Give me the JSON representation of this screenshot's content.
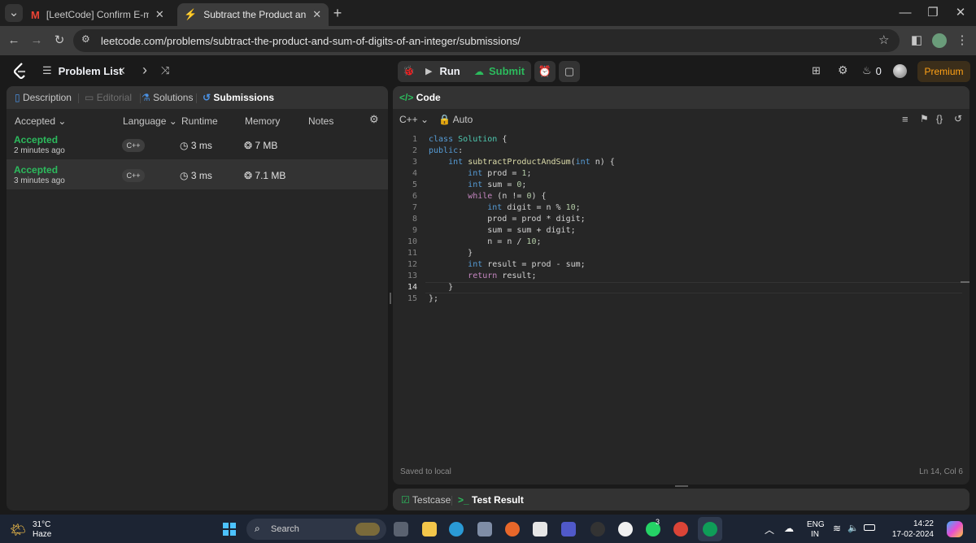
{
  "browser": {
    "tabs": [
      {
        "title": "[LeetCode] Confirm E-mail Add",
        "icon": "gmail-icon"
      },
      {
        "title": "Subtract the Product and Sum o",
        "icon": "leetcode-icon"
      }
    ],
    "url": "leetcode.com/problems/subtract-the-product-and-sum-of-digits-of-an-integer/submissions/"
  },
  "header": {
    "problem_list": "Problem List",
    "run": "Run",
    "submit": "Submit",
    "streak": "0",
    "premium": "Premium"
  },
  "left_panel": {
    "tabs": [
      "Description",
      "Editorial",
      "Solutions",
      "Submissions"
    ],
    "columns": {
      "status": "Accepted",
      "language": "Language",
      "runtime": "Runtime",
      "memory": "Memory",
      "notes": "Notes"
    },
    "submissions": [
      {
        "status": "Accepted",
        "time": "2 minutes ago",
        "lang": "C++",
        "runtime": "3 ms",
        "memory": "7 MB"
      },
      {
        "status": "Accepted",
        "time": "3 minutes ago",
        "lang": "C++",
        "runtime": "3 ms",
        "memory": "7.1 MB"
      }
    ]
  },
  "code_panel": {
    "title": "Code",
    "language": "C++",
    "auto": "Auto",
    "saved": "Saved to local",
    "cursor": "Ln 14, Col 6",
    "lines": [
      "class Solution {",
      "public:",
      "    int subtractProductAndSum(int n) {",
      "        int prod = 1;",
      "        int sum = 0;",
      "        while (n != 0) {",
      "            int digit = n % 10;",
      "            prod = prod * digit;",
      "            sum = sum + digit;",
      "            n = n / 10;",
      "        }",
      "        int result = prod - sum;",
      "        return result;",
      "    }",
      "};"
    ]
  },
  "bottom_panel": {
    "testcase": "Testcase",
    "test_result": "Test Result"
  },
  "taskbar": {
    "temperature": "31°C",
    "weather": "Haze",
    "search": "Search",
    "lang": "ENG",
    "region": "IN",
    "time": "14:22",
    "date": "17-02-2024",
    "badge": "3"
  },
  "colors": {
    "accent_green": "#2cbb5d",
    "premium": "#ffa116",
    "panel": "#262626",
    "bg": "#1a1a1a"
  }
}
